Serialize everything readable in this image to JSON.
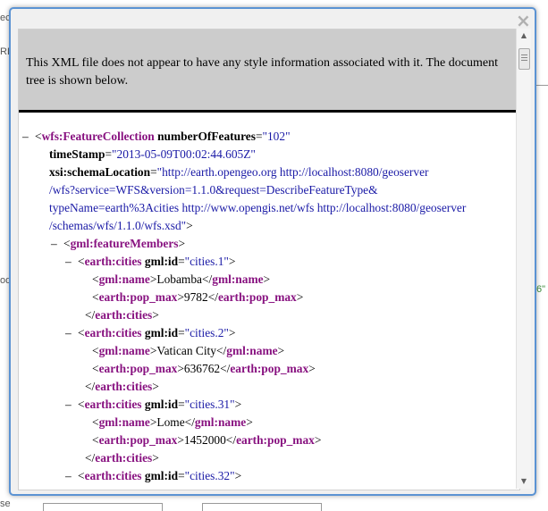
{
  "background": {
    "fragments": [
      "ec",
      "RL",
      "ody"
    ],
    "right_fragment": "6\"",
    "bottom_fragment": "se"
  },
  "dialog": {
    "close_symbol": "×",
    "info_message": "This XML file does not appear to have any style information associated with it. The document tree is shown below.",
    "toggle_symbol": "–",
    "lines": [
      {
        "indent": 0,
        "toggle": true,
        "parts": [
          [
            "p",
            "<"
          ],
          [
            "tag",
            "wfs:FeatureCollection"
          ],
          [
            "p",
            " "
          ],
          [
            "attr",
            "numberOfFeatures"
          ],
          [
            "p",
            "="
          ],
          [
            "val",
            "\"102\""
          ]
        ]
      },
      {
        "indent": 1,
        "toggle": false,
        "parts": [
          [
            "attr",
            "timeStamp"
          ],
          [
            "p",
            "="
          ],
          [
            "val",
            "\"2013-05-09T00:02:44.605Z\""
          ]
        ]
      },
      {
        "indent": 1,
        "toggle": false,
        "parts": [
          [
            "attr",
            "xsi:schemaLocation"
          ],
          [
            "p",
            "="
          ],
          [
            "val",
            "\"http://earth.opengeo.org http://localhost:8080/geoserver"
          ]
        ]
      },
      {
        "indent": 1,
        "toggle": false,
        "parts": [
          [
            "val",
            "/wfs?service=WFS&version=1.1.0&request=DescribeFeatureType&"
          ]
        ]
      },
      {
        "indent": 1,
        "toggle": false,
        "parts": [
          [
            "val",
            "typeName=earth%3Acities http://www.opengis.net/wfs http://localhost:8080/geoserver"
          ]
        ]
      },
      {
        "indent": 1,
        "toggle": false,
        "parts": [
          [
            "val",
            "/schemas/wfs/1.1.0/wfs.xsd\""
          ],
          [
            "p",
            ">"
          ]
        ]
      },
      {
        "indent": 2,
        "toggle": true,
        "parts": [
          [
            "p",
            "<"
          ],
          [
            "tag",
            "gml:featureMembers"
          ],
          [
            "p",
            ">"
          ]
        ]
      },
      {
        "indent": 3,
        "toggle": true,
        "parts": [
          [
            "p",
            "<"
          ],
          [
            "tag",
            "earth:cities"
          ],
          [
            "p",
            " "
          ],
          [
            "attr",
            "gml:id"
          ],
          [
            "p",
            "="
          ],
          [
            "val",
            "\"cities.1\""
          ],
          [
            "p",
            ">"
          ]
        ]
      },
      {
        "indent": 4,
        "toggle": false,
        "parts": [
          [
            "p",
            "<"
          ],
          [
            "tag",
            "gml:name"
          ],
          [
            "p",
            ">"
          ],
          [
            "text",
            "Lobamba"
          ],
          [
            "p",
            "</"
          ],
          [
            "tag",
            "gml:name"
          ],
          [
            "p",
            ">"
          ]
        ]
      },
      {
        "indent": 4,
        "toggle": false,
        "parts": [
          [
            "p",
            "<"
          ],
          [
            "tag",
            "earth:pop_max"
          ],
          [
            "p",
            ">"
          ],
          [
            "text",
            "9782"
          ],
          [
            "p",
            "</"
          ],
          [
            "tag",
            "earth:pop_max"
          ],
          [
            "p",
            ">"
          ]
        ]
      },
      {
        "indent": 3.5,
        "toggle": false,
        "parts": [
          [
            "p",
            "</"
          ],
          [
            "tag",
            "earth:cities"
          ],
          [
            "p",
            ">"
          ]
        ]
      },
      {
        "indent": 3,
        "toggle": true,
        "parts": [
          [
            "p",
            "<"
          ],
          [
            "tag",
            "earth:cities"
          ],
          [
            "p",
            " "
          ],
          [
            "attr",
            "gml:id"
          ],
          [
            "p",
            "="
          ],
          [
            "val",
            "\"cities.2\""
          ],
          [
            "p",
            ">"
          ]
        ]
      },
      {
        "indent": 4,
        "toggle": false,
        "parts": [
          [
            "p",
            "<"
          ],
          [
            "tag",
            "gml:name"
          ],
          [
            "p",
            ">"
          ],
          [
            "text",
            "Vatican City"
          ],
          [
            "p",
            "</"
          ],
          [
            "tag",
            "gml:name"
          ],
          [
            "p",
            ">"
          ]
        ]
      },
      {
        "indent": 4,
        "toggle": false,
        "parts": [
          [
            "p",
            "<"
          ],
          [
            "tag",
            "earth:pop_max"
          ],
          [
            "p",
            ">"
          ],
          [
            "text",
            "636762"
          ],
          [
            "p",
            "</"
          ],
          [
            "tag",
            "earth:pop_max"
          ],
          [
            "p",
            ">"
          ]
        ]
      },
      {
        "indent": 3.5,
        "toggle": false,
        "parts": [
          [
            "p",
            "</"
          ],
          [
            "tag",
            "earth:cities"
          ],
          [
            "p",
            ">"
          ]
        ]
      },
      {
        "indent": 3,
        "toggle": true,
        "parts": [
          [
            "p",
            "<"
          ],
          [
            "tag",
            "earth:cities"
          ],
          [
            "p",
            " "
          ],
          [
            "attr",
            "gml:id"
          ],
          [
            "p",
            "="
          ],
          [
            "val",
            "\"cities.31\""
          ],
          [
            "p",
            ">"
          ]
        ]
      },
      {
        "indent": 4,
        "toggle": false,
        "parts": [
          [
            "p",
            "<"
          ],
          [
            "tag",
            "gml:name"
          ],
          [
            "p",
            ">"
          ],
          [
            "text",
            "Lome"
          ],
          [
            "p",
            "</"
          ],
          [
            "tag",
            "gml:name"
          ],
          [
            "p",
            ">"
          ]
        ]
      },
      {
        "indent": 4,
        "toggle": false,
        "parts": [
          [
            "p",
            "<"
          ],
          [
            "tag",
            "earth:pop_max"
          ],
          [
            "p",
            ">"
          ],
          [
            "text",
            "1452000"
          ],
          [
            "p",
            "</"
          ],
          [
            "tag",
            "earth:pop_max"
          ],
          [
            "p",
            ">"
          ]
        ]
      },
      {
        "indent": 3.5,
        "toggle": false,
        "parts": [
          [
            "p",
            "</"
          ],
          [
            "tag",
            "earth:cities"
          ],
          [
            "p",
            ">"
          ]
        ]
      },
      {
        "indent": 3,
        "toggle": true,
        "parts": [
          [
            "p",
            "<"
          ],
          [
            "tag",
            "earth:cities"
          ],
          [
            "p",
            " "
          ],
          [
            "attr",
            "gml:id"
          ],
          [
            "p",
            "="
          ],
          [
            "val",
            "\"cities.32\""
          ],
          [
            "p",
            ">"
          ]
        ]
      }
    ]
  },
  "scrollbar": {
    "up_symbol": "▲",
    "down_symbol": "▼"
  },
  "colors": {
    "tag": "#881280",
    "value": "#1a1aa6",
    "dialog_border": "#5b93d3",
    "info_bg": "#cccccc"
  }
}
